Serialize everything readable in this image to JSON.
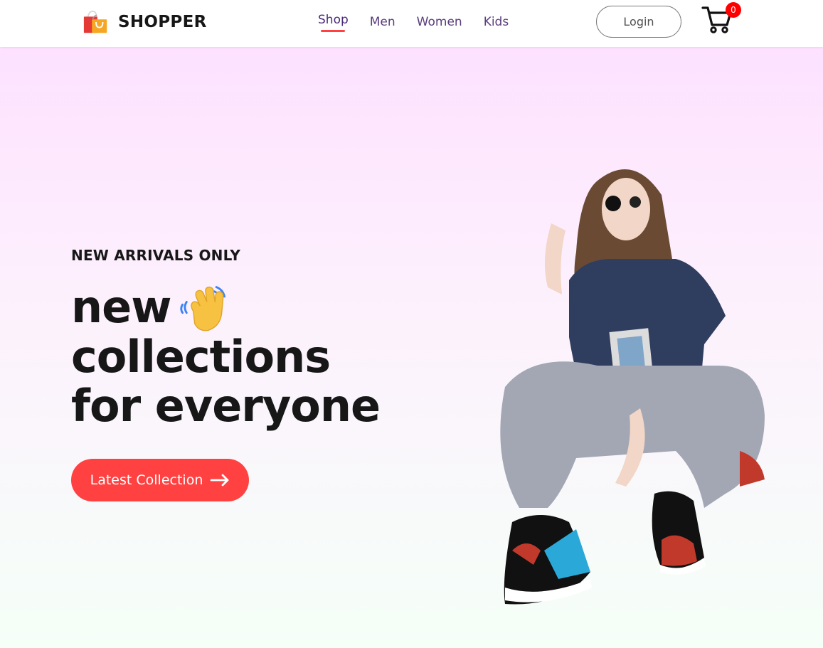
{
  "nav": {
    "brand": "SHOPPER",
    "menu": [
      "Shop",
      "Men",
      "Women",
      "Kids"
    ],
    "active": "Shop",
    "login": "Login",
    "cart_count": "0"
  },
  "hero": {
    "tag": "NEW ARRIVALS ONLY",
    "line1": "new",
    "line2": "collections",
    "line3": "for everyone",
    "cta": "Latest Collection"
  },
  "colors": {
    "accent": "#ff4141",
    "hero_top": "#fde1ff",
    "hero_bottom": "#f5fff8",
    "text": "#171717"
  },
  "icons": [
    "shopping-bag-logo-icon",
    "cart-icon",
    "waving-hand-icon",
    "arrow-right-icon"
  ]
}
